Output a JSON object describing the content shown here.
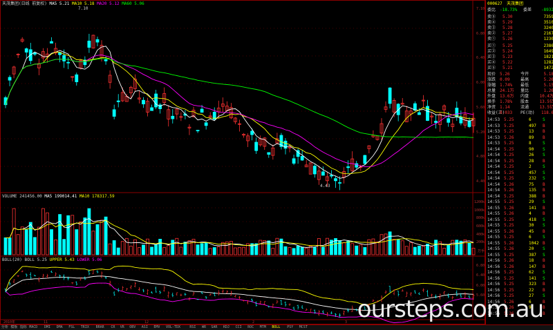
{
  "colors": {
    "up": "#ff3232",
    "down": "#00ffff",
    "ma5": "#ffffff",
    "ma10": "#ffff00",
    "ma20": "#ff00ff",
    "ma60": "#00ff00",
    "grid": "#8b0000"
  },
  "price_panel": {
    "header": [
      {
        "text": "天茂集团(日线 前复权)",
        "color": "#cfcfcf"
      },
      {
        "text": "MA5 5.21",
        "color": "#ffffff"
      },
      {
        "text": "MA10 5.18",
        "color": "#ffff00"
      },
      {
        "text": "MA20 5.12",
        "color": "#ff00ff"
      },
      {
        "text": "MA60 5.06",
        "color": "#00ff00"
      }
    ],
    "high_label": "7.10",
    "low_label": "4.43",
    "y_labels": [
      "7.10",
      "6.80",
      "6.40",
      "6.00",
      "5.60",
      "5.20",
      "4.80",
      "4.40"
    ]
  },
  "volume_panel": {
    "header": [
      {
        "text": "VOLUME 241456.00",
        "color": "#cfcfcf"
      },
      {
        "text": "MA5 199014.41",
        "color": "#ffffff"
      },
      {
        "text": "MA10 178317.59",
        "color": "#ffff00"
      }
    ],
    "y_labels": [
      "1200k",
      "1000k",
      "800k",
      "600k",
      "400k",
      "200k",
      "万手"
    ]
  },
  "boll_panel": {
    "header": [
      {
        "text": "BOLL(20) BOLL 5.25",
        "color": "#cfcfcf"
      },
      {
        "text": "UPPER 5.43",
        "color": "#ffff00"
      },
      {
        "text": "LOWER 5.06",
        "color": "#ff00ff"
      }
    ],
    "y_labels": [
      "6.80",
      "6.40",
      "6.00",
      "5.60",
      "5.20",
      "4.80"
    ]
  },
  "date_axis": [
    "2010年",
    "11",
    "12",
    "2",
    "3"
  ],
  "tabs": [
    "分析",
    "模板",
    "指标",
    "MACD",
    "DMI",
    "DMA",
    "FSL",
    "TRIX",
    "BRAR",
    "CR",
    "VR",
    "OBV",
    "ASI",
    "EMV",
    "VOL-TDX",
    "RSI",
    "WR",
    "SAR",
    "KDJ",
    "CCI",
    "ROC",
    "MTM",
    "BOLL",
    "PSY",
    "MCST"
  ],
  "active_tab": "BOLL",
  "quote": {
    "code": "000627",
    "name": "天茂集团",
    "weibi_label": "委比",
    "weibi_val": "-18.73%",
    "weicha_label": "委差",
    "weicha_val": "-8932",
    "sells": [
      {
        "label": "卖⑤",
        "price": "5.30",
        "vol": "7359"
      },
      {
        "label": "卖④",
        "price": "5.29",
        "vol": "3510"
      },
      {
        "label": "卖③",
        "price": "5.28",
        "vol": "3240"
      },
      {
        "label": "卖②",
        "price": "5.27",
        "vol": "2167"
      },
      {
        "label": "卖①",
        "price": "5.26",
        "vol": "1230"
      }
    ],
    "buys": [
      {
        "label": "买①",
        "price": "5.25",
        "vol": "2386"
      },
      {
        "label": "买②",
        "price": "5.24",
        "vol": "1649"
      },
      {
        "label": "买③",
        "price": "5.23",
        "vol": "1821"
      },
      {
        "label": "买④",
        "price": "5.22",
        "vol": "1282"
      },
      {
        "label": "买⑤",
        "price": "5.21",
        "vol": "1472"
      }
    ],
    "stats": [
      {
        "l1": "现价",
        "v1": "5.26",
        "l2": "今开",
        "v2": "5.18"
      },
      {
        "l1": "涨跌",
        "v1": "0.09",
        "l2": "最高",
        "v2": "5.26"
      },
      {
        "l1": "涨幅",
        "v1": "1.74%",
        "l2": "最低",
        "v2": "5.15"
      },
      {
        "l1": "总量",
        "v1": "24.1万",
        "l2": "量比",
        "v2": "1.26"
      },
      {
        "l1": "外盘",
        "v1": "13.6万",
        "l2": "内盘",
        "v2": "10.4万"
      },
      {
        "l1": "换手",
        "v1": "1.78%",
        "l2": "股本",
        "v2": "13.5亿"
      },
      {
        "l1": "净资",
        "v1": "1.14",
        "l2": "流通",
        "v2": "13.5亿"
      },
      {
        "l1": "收益(三)",
        "v1": "0.033",
        "l2": "PE(动)",
        "v2": "118.6"
      }
    ],
    "ticks": [
      {
        "t": "14:53",
        "p": "5.25",
        "v": "6",
        "f": "S"
      },
      {
        "t": "14:53",
        "p": "5.25",
        "v": "497",
        "f": "B"
      },
      {
        "t": "14:53",
        "p": "5.25",
        "v": "13",
        "f": "B"
      },
      {
        "t": "14:53",
        "p": "5.26",
        "v": "89",
        "f": "B"
      },
      {
        "t": "14:53",
        "p": "5.25",
        "v": "8",
        "f": "S"
      },
      {
        "t": "14:54",
        "p": "5.25",
        "v": "90",
        "f": "S"
      },
      {
        "t": "14:54",
        "p": "5.25",
        "v": "26",
        "f": "S"
      },
      {
        "t": "14:54",
        "p": "5.25",
        "v": "28",
        "f": "B"
      },
      {
        "t": "14:54",
        "p": "5.25",
        "v": "2",
        "f": "S"
      },
      {
        "t": "14:54",
        "p": "5.25",
        "v": "457",
        "f": "S"
      },
      {
        "t": "14:54",
        "p": "5.25",
        "v": "232",
        "f": "S"
      },
      {
        "t": "14:54",
        "p": "5.26",
        "v": "75",
        "f": "B"
      },
      {
        "t": "14:54",
        "p": "5.26",
        "v": "135",
        "f": "B"
      },
      {
        "t": "14:54",
        "p": "5.25",
        "v": "388",
        "f": "B"
      },
      {
        "t": "14:55",
        "p": "5.25",
        "v": "29",
        "f": "S"
      },
      {
        "t": "14:55",
        "p": "5.26",
        "v": "141",
        "f": "B"
      },
      {
        "t": "14:55",
        "p": "5.26",
        "v": "4",
        "f": "B"
      },
      {
        "t": "14:55",
        "p": "5.25",
        "v": "418",
        "f": "S"
      },
      {
        "t": "14:55",
        "p": "5.25",
        "v": "30",
        "f": "S"
      },
      {
        "t": "14:55",
        "p": "5.26",
        "v": "45",
        "f": "B"
      },
      {
        "t": "14:55",
        "p": "5.25",
        "v": "6",
        "f": "S"
      },
      {
        "t": "14:55",
        "p": "5.26",
        "v": "1042",
        "f": "B"
      },
      {
        "t": "14:55",
        "p": "5.26",
        "v": "20",
        "f": "S"
      },
      {
        "t": "14:55",
        "p": "5.25",
        "v": "387",
        "f": "S"
      },
      {
        "t": "14:56",
        "p": "5.26",
        "v": "18",
        "f": "B"
      },
      {
        "t": "14:56",
        "p": "5.26",
        "v": "147",
        "f": "B"
      },
      {
        "t": "14:56",
        "p": "5.25",
        "v": "62",
        "f": "S"
      },
      {
        "t": "14:56",
        "p": "5.25",
        "v": "141",
        "f": "S"
      },
      {
        "t": "14:56",
        "p": "5.25",
        "v": "323",
        "f": "B"
      },
      {
        "t": "14:56",
        "p": "5.25",
        "v": "22",
        "f": "B"
      },
      {
        "t": "14:56",
        "p": "5.25",
        "v": "27",
        "f": "S"
      },
      {
        "t": "14:56",
        "p": "5.26",
        "v": "6",
        "f": "B"
      },
      {
        "t": "14:56",
        "p": "5.26",
        "v": "9",
        "f": "B"
      },
      {
        "t": "14:56",
        "p": "5.26",
        "v": "",
        "f": "B"
      }
    ]
  },
  "watermark": "oursteps.com.au"
}
